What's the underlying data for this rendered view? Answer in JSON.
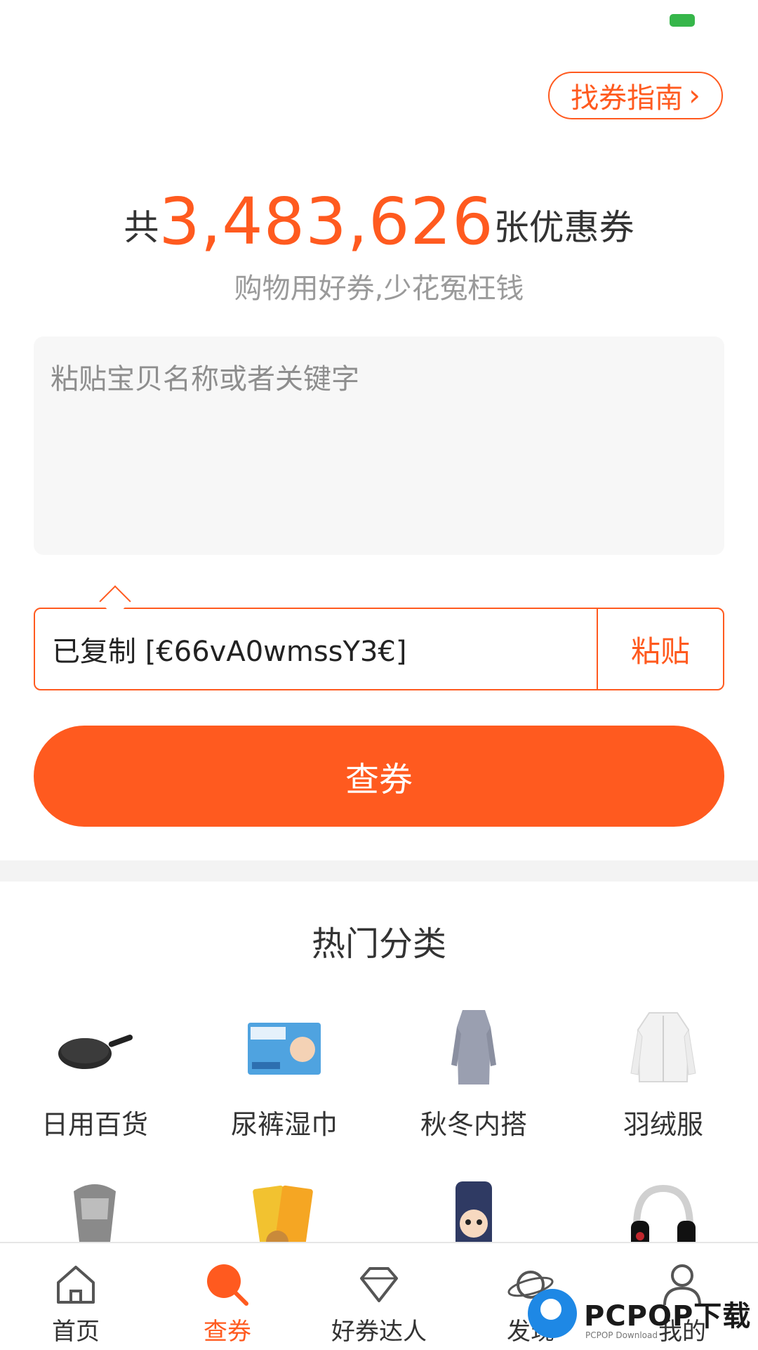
{
  "header": {
    "guide_label": "找券指南"
  },
  "stats": {
    "prefix": "共",
    "count": "3,483,626",
    "suffix": "张优惠券",
    "slogan": "购物用好券,少花冤枉钱"
  },
  "search": {
    "placeholder": "粘贴宝贝名称或者关键字",
    "clipboard_text": "已复制 [€66vA0wmssY3€]",
    "paste_label": "粘贴",
    "submit_label": "查券"
  },
  "categories": {
    "title": "热门分类",
    "items": [
      {
        "label": "日用百货",
        "icon": "frying-pan-icon"
      },
      {
        "label": "尿裤湿巾",
        "icon": "diapers-icon"
      },
      {
        "label": "秋冬内搭",
        "icon": "sweater-dress-icon"
      },
      {
        "label": "羽绒服",
        "icon": "down-jacket-icon"
      },
      {
        "label": "",
        "icon": "scarf-icon"
      },
      {
        "label": "",
        "icon": "snacks-icon"
      },
      {
        "label": "",
        "icon": "phone-case-icon"
      },
      {
        "label": "",
        "icon": "headphones-icon"
      }
    ]
  },
  "tabbar": {
    "items": [
      {
        "label": "首页",
        "icon": "home-icon"
      },
      {
        "label": "查券",
        "icon": "search-coupon-icon",
        "active": true
      },
      {
        "label": "好券达人",
        "icon": "diamond-icon"
      },
      {
        "label": "发现",
        "icon": "planet-icon"
      },
      {
        "label": "我的",
        "icon": "user-icon"
      }
    ]
  },
  "watermark": {
    "brand": "PCPOP下载",
    "sub": "PCPOP Download"
  },
  "colors": {
    "accent": "#ff5a1f",
    "status_battery": "#36b64a"
  }
}
